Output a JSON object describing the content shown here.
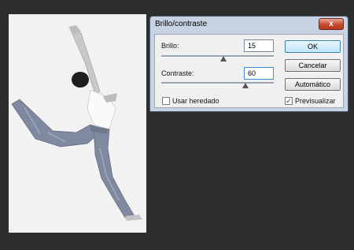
{
  "dialog": {
    "title": "Brillo/contraste",
    "close_label": "x",
    "brightness": {
      "label": "Brillo:",
      "value": "15",
      "slider_fraction": 0.55
    },
    "contrast": {
      "label": "Contraste:",
      "value": "60",
      "slider_fraction": 0.75
    },
    "buttons": {
      "ok": "OK",
      "cancel": "Cancelar",
      "auto": "Automático"
    },
    "legacy": {
      "label": "Usar heredado",
      "checked": false
    },
    "preview": {
      "label": "Previsualizar",
      "checked": true,
      "mark": "✓"
    }
  },
  "colors": {
    "titlebar": "#c7d3e3",
    "close": "#c64a2e",
    "workspace": "#2d2d2d"
  },
  "canvas": {
    "subject": "dancer-leaping-photo"
  }
}
